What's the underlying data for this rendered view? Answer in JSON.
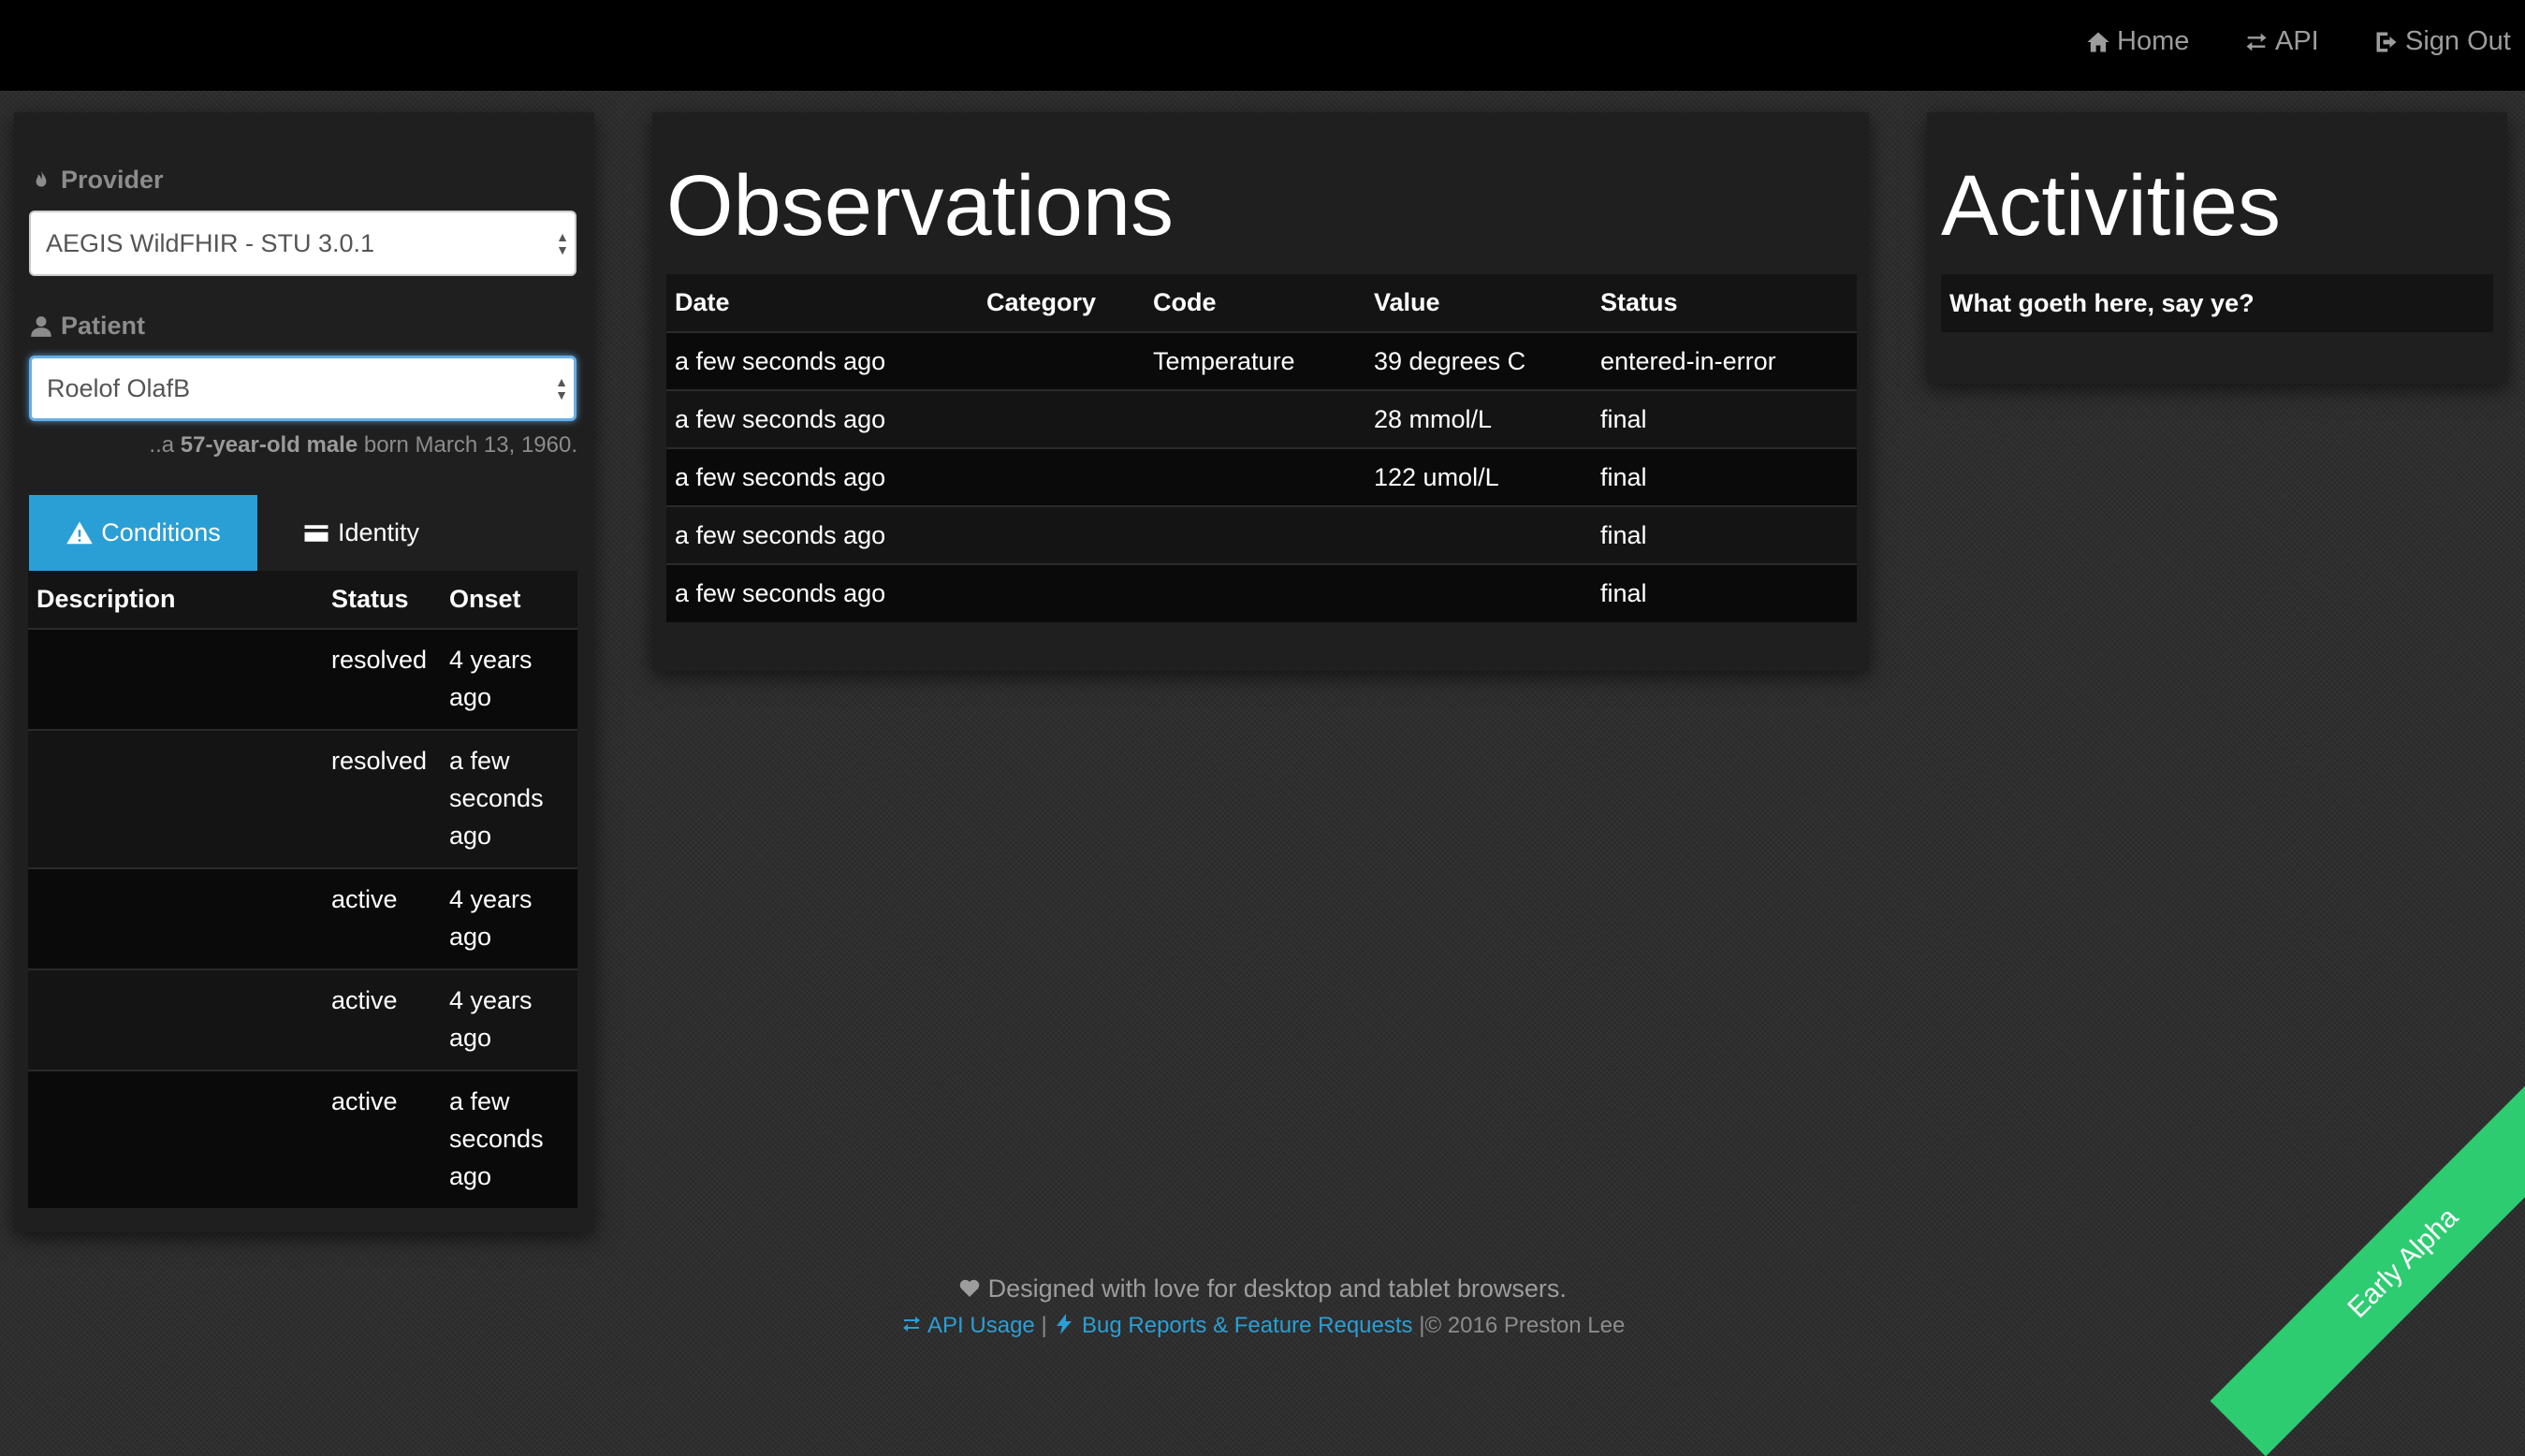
{
  "nav": {
    "home": "Home",
    "api": "API",
    "sign_out": "Sign Out"
  },
  "sidebar": {
    "provider_label": "Provider",
    "provider_value": "AEGIS WildFHIR - STU 3.0.1",
    "patient_label": "Patient",
    "patient_value": "Roelof OlafB",
    "patient_info_prefix": "..a ",
    "patient_info_bold": "57-year-old male",
    "patient_info_suffix": " born March 13, 1960.",
    "tabs": [
      {
        "label": "Conditions",
        "icon": "warning-icon"
      },
      {
        "label": "Identity",
        "icon": "id-card-icon"
      }
    ],
    "conditions": {
      "headers": [
        "Description",
        "Status",
        "Onset"
      ],
      "rows": [
        {
          "description": "",
          "status": "resolved",
          "onset": "4 years ago"
        },
        {
          "description": "",
          "status": "resolved",
          "onset": "a few seconds ago"
        },
        {
          "description": "",
          "status": "active",
          "onset": "4 years ago"
        },
        {
          "description": "",
          "status": "active",
          "onset": "4 years ago"
        },
        {
          "description": "",
          "status": "active",
          "onset": "a few seconds ago"
        }
      ]
    }
  },
  "observations": {
    "title": "Observations",
    "headers": [
      "Date",
      "Category",
      "Code",
      "Value",
      "Status"
    ],
    "rows": [
      {
        "date": "a few seconds ago",
        "category": "",
        "code": "Temperature",
        "value": "39 degrees C",
        "status": "entered-in-error"
      },
      {
        "date": "a few seconds ago",
        "category": "",
        "code": "",
        "value": "28 mmol/L",
        "status": "final"
      },
      {
        "date": "a few seconds ago",
        "category": "",
        "code": "",
        "value": "122 umol/L",
        "status": "final"
      },
      {
        "date": "a few seconds ago",
        "category": "",
        "code": "",
        "value": "",
        "status": "final"
      },
      {
        "date": "a few seconds ago",
        "category": "",
        "code": "",
        "value": "",
        "status": "final"
      }
    ]
  },
  "activities": {
    "title": "Activities",
    "header": "What goeth here, say ye?"
  },
  "footer": {
    "tagline": "Designed with love for desktop and tablet browsers.",
    "api_usage": "API Usage",
    "sep": "|",
    "bug_reports": "Bug Reports & Feature Requests",
    "copyright": "|© 2016 Preston Lee"
  },
  "ribbon": "Early Alpha",
  "colors": {
    "accent": "#2a9fd6",
    "ribbon": "#2ecc71",
    "navbar": "#000000"
  }
}
